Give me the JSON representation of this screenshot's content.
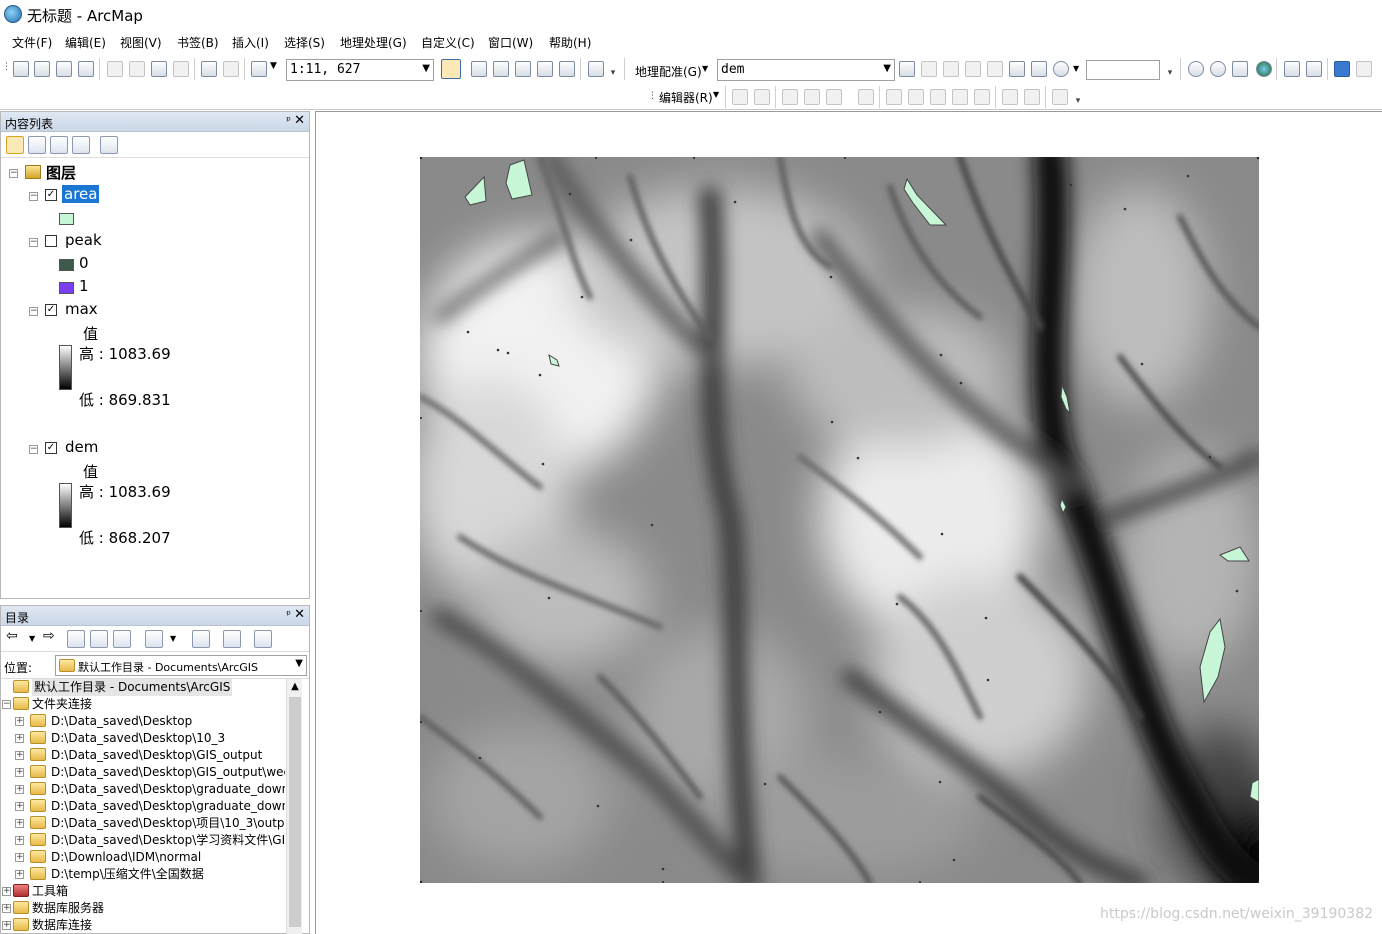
{
  "window": {
    "title": "无标题 - ArcMap"
  },
  "menu": [
    "文件(F)",
    "编辑(E)",
    "视图(V)",
    "书签(B)",
    "插入(I)",
    "选择(S)",
    "地理处理(G)",
    "自定义(C)",
    "窗口(W)",
    "帮助(H)"
  ],
  "toolbar": {
    "scale_value": "1:11, 627",
    "georef_label": "地理配准(G)",
    "georef_layer": "dem",
    "editor_label": "编辑器(R)"
  },
  "toc": {
    "title": "内容列表",
    "pin": "ᵖ",
    "close": "✕",
    "root": "图层",
    "layers": {
      "area": {
        "name": "area",
        "checked": true
      },
      "peak": {
        "name": "peak",
        "checked": false,
        "classes": [
          "0",
          "1"
        ]
      },
      "max": {
        "name": "max",
        "checked": true,
        "field": "值",
        "high": "高 : 1083.69",
        "low": "低 : 869.831"
      },
      "dem": {
        "name": "dem",
        "checked": true,
        "field": "值",
        "high": "高 : 1083.69",
        "low": "低 : 868.207"
      }
    }
  },
  "catalog": {
    "title": "目录",
    "location_label": "位置:",
    "location_value": "默认工作目录 - Documents\\ArcGIS",
    "items": [
      {
        "label": "默认工作目录 - Documents\\ArcGIS",
        "highlight": true
      },
      {
        "label": "文件夹连接"
      },
      {
        "label": "D:\\Data_saved\\Desktop"
      },
      {
        "label": "D:\\Data_saved\\Desktop\\10_3"
      },
      {
        "label": "D:\\Data_saved\\Desktop\\GIS_output"
      },
      {
        "label": "D:\\Data_saved\\Desktop\\GIS_output\\wee"
      },
      {
        "label": "D:\\Data_saved\\Desktop\\graduate_down"
      },
      {
        "label": "D:\\Data_saved\\Desktop\\graduate_down"
      },
      {
        "label": "D:\\Data_saved\\Desktop\\项目\\10_3\\outpu"
      },
      {
        "label": "D:\\Data_saved\\Desktop\\学习资料文件\\GI"
      },
      {
        "label": "D:\\Download\\IDM\\normal"
      },
      {
        "label": "D:\\temp\\压缩文件\\全国数据"
      },
      {
        "label": "工具箱"
      },
      {
        "label": "数据库服务器"
      },
      {
        "label": "数据库连接"
      }
    ]
  },
  "colors": {
    "area_fill": "#c8f7d8",
    "peak_0": "#3e5a4a",
    "peak_1": "#7a3ff0",
    "selection": "#1976d2"
  },
  "watermark": "https://blog.csdn.net/weixin_39190382"
}
